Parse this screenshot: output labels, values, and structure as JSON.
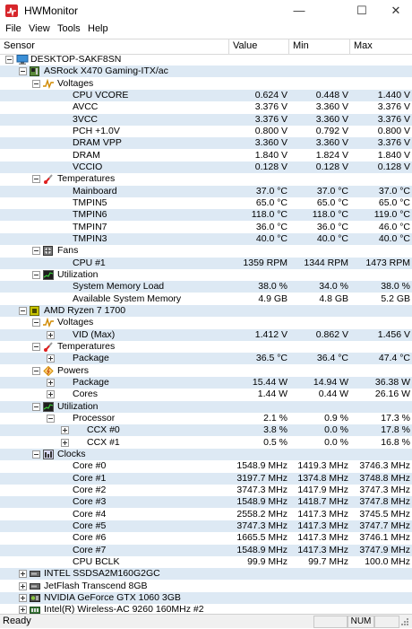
{
  "window": {
    "title": "HWMonitor",
    "minimize": "—",
    "maximize": "☐",
    "close": "✕"
  },
  "menu": [
    "File",
    "View",
    "Tools",
    "Help"
  ],
  "columns": {
    "sensor": "Sensor",
    "value": "Value",
    "min": "Min",
    "max": "Max"
  },
  "tree": [
    {
      "level": 0,
      "type": "root",
      "label": "DESKTOP-SAKF8SN",
      "expander": "minus",
      "icon": "computer-icon"
    },
    {
      "level": 1,
      "type": "device",
      "label": "ASRock X470 Gaming-ITX/ac",
      "expander": "minus",
      "icon": "motherboard-icon"
    },
    {
      "level": 2,
      "type": "group",
      "label": "Voltages",
      "expander": "minus",
      "icon": "voltage-icon"
    },
    {
      "level": 3,
      "type": "sensor",
      "label": "CPU VCORE",
      "value": "0.624 V",
      "min": "0.448 V",
      "max": "1.440 V"
    },
    {
      "level": 3,
      "type": "sensor",
      "label": "AVCC",
      "value": "3.376 V",
      "min": "3.360 V",
      "max": "3.376 V"
    },
    {
      "level": 3,
      "type": "sensor",
      "label": "3VCC",
      "value": "3.376 V",
      "min": "3.360 V",
      "max": "3.376 V"
    },
    {
      "level": 3,
      "type": "sensor",
      "label": "PCH +1.0V",
      "value": "0.800 V",
      "min": "0.792 V",
      "max": "0.800 V"
    },
    {
      "level": 3,
      "type": "sensor",
      "label": "DRAM VPP",
      "value": "3.360 V",
      "min": "3.360 V",
      "max": "3.376 V"
    },
    {
      "level": 3,
      "type": "sensor",
      "label": "DRAM",
      "value": "1.840 V",
      "min": "1.824 V",
      "max": "1.840 V"
    },
    {
      "level": 3,
      "type": "sensor",
      "label": "VCCIO",
      "value": "0.128 V",
      "min": "0.128 V",
      "max": "0.128 V"
    },
    {
      "level": 2,
      "type": "group",
      "label": "Temperatures",
      "expander": "minus",
      "icon": "thermometer-icon"
    },
    {
      "level": 3,
      "type": "sensor",
      "label": "Mainboard",
      "value": "37.0 °C",
      "min": "37.0 °C",
      "max": "37.0 °C"
    },
    {
      "level": 3,
      "type": "sensor",
      "label": "TMPIN5",
      "value": "65.0 °C",
      "min": "65.0 °C",
      "max": "65.0 °C"
    },
    {
      "level": 3,
      "type": "sensor",
      "label": "TMPIN6",
      "value": "118.0 °C",
      "min": "118.0 °C",
      "max": "119.0 °C"
    },
    {
      "level": 3,
      "type": "sensor",
      "label": "TMPIN7",
      "value": "36.0 °C",
      "min": "36.0 °C",
      "max": "46.0 °C"
    },
    {
      "level": 3,
      "type": "sensor",
      "label": "TMPIN3",
      "value": "40.0 °C",
      "min": "40.0 °C",
      "max": "40.0 °C"
    },
    {
      "level": 2,
      "type": "group",
      "label": "Fans",
      "expander": "minus",
      "icon": "fan-icon"
    },
    {
      "level": 3,
      "type": "sensor",
      "label": "CPU #1",
      "value": "1359 RPM",
      "min": "1344 RPM",
      "max": "1473 RPM"
    },
    {
      "level": 2,
      "type": "group",
      "label": "Utilization",
      "expander": "minus",
      "icon": "utilization-icon"
    },
    {
      "level": 3,
      "type": "sensor",
      "label": "System Memory Load",
      "value": "38.0 %",
      "min": "34.0 %",
      "max": "38.0 %"
    },
    {
      "level": 3,
      "type": "sensor",
      "label": "Available System Memory",
      "value": "4.9 GB",
      "min": "4.8 GB",
      "max": "5.2 GB"
    },
    {
      "level": 1,
      "type": "device",
      "label": "AMD Ryzen 7 1700",
      "expander": "minus",
      "icon": "cpu-icon"
    },
    {
      "level": 2,
      "type": "group",
      "label": "Voltages",
      "expander": "minus",
      "icon": "voltage-icon"
    },
    {
      "level": 3,
      "type": "sensor",
      "label": "VID (Max)",
      "value": "1.412 V",
      "min": "0.862 V",
      "max": "1.456 V",
      "expander": "plus"
    },
    {
      "level": 2,
      "type": "group",
      "label": "Temperatures",
      "expander": "minus",
      "icon": "thermometer-icon"
    },
    {
      "level": 3,
      "type": "sensor",
      "label": "Package",
      "value": "36.5 °C",
      "min": "36.4 °C",
      "max": "47.4 °C",
      "expander": "plus"
    },
    {
      "level": 2,
      "type": "group",
      "label": "Powers",
      "expander": "minus",
      "icon": "power-icon"
    },
    {
      "level": 3,
      "type": "sensor",
      "label": "Package",
      "value": "15.44 W",
      "min": "14.94 W",
      "max": "36.38 W",
      "expander": "plus"
    },
    {
      "level": 3,
      "type": "sensor",
      "label": "Cores",
      "value": "1.44 W",
      "min": "0.44 W",
      "max": "26.16 W",
      "expander": "plus"
    },
    {
      "level": 2,
      "type": "group",
      "label": "Utilization",
      "expander": "minus",
      "icon": "utilization-icon"
    },
    {
      "level": 3,
      "type": "sensor",
      "label": "Processor",
      "value": "2.1 %",
      "min": "0.9 %",
      "max": "17.3 %",
      "expander": "minus"
    },
    {
      "level": 4,
      "type": "sensor",
      "label": "CCX #0",
      "value": "3.8 %",
      "min": "0.0 %",
      "max": "17.8 %",
      "expander": "plus"
    },
    {
      "level": 4,
      "type": "sensor",
      "label": "CCX #1",
      "value": "0.5 %",
      "min": "0.0 %",
      "max": "16.8 %",
      "expander": "plus"
    },
    {
      "level": 2,
      "type": "group",
      "label": "Clocks",
      "expander": "minus",
      "icon": "clock-icon"
    },
    {
      "level": 3,
      "type": "sensor",
      "label": "Core #0",
      "value": "1548.9 MHz",
      "min": "1419.3 MHz",
      "max": "3746.3 MHz"
    },
    {
      "level": 3,
      "type": "sensor",
      "label": "Core #1",
      "value": "3197.7 MHz",
      "min": "1374.8 MHz",
      "max": "3748.8 MHz"
    },
    {
      "level": 3,
      "type": "sensor",
      "label": "Core #2",
      "value": "3747.3 MHz",
      "min": "1417.9 MHz",
      "max": "3747.3 MHz"
    },
    {
      "level": 3,
      "type": "sensor",
      "label": "Core #3",
      "value": "1548.9 MHz",
      "min": "1418.7 MHz",
      "max": "3747.8 MHz"
    },
    {
      "level": 3,
      "type": "sensor",
      "label": "Core #4",
      "value": "2558.2 MHz",
      "min": "1417.3 MHz",
      "max": "3745.5 MHz"
    },
    {
      "level": 3,
      "type": "sensor",
      "label": "Core #5",
      "value": "3747.3 MHz",
      "min": "1417.3 MHz",
      "max": "3747.7 MHz"
    },
    {
      "level": 3,
      "type": "sensor",
      "label": "Core #6",
      "value": "1665.5 MHz",
      "min": "1417.3 MHz",
      "max": "3746.1 MHz"
    },
    {
      "level": 3,
      "type": "sensor",
      "label": "Core #7",
      "value": "1548.9 MHz",
      "min": "1417.3 MHz",
      "max": "3747.9 MHz"
    },
    {
      "level": 3,
      "type": "sensor",
      "label": "CPU BCLK",
      "value": "99.9 MHz",
      "min": "99.7 MHz",
      "max": "100.0 MHz"
    },
    {
      "level": 1,
      "type": "device",
      "label": "INTEL SSDSA2M160G2GC",
      "expander": "plus",
      "icon": "drive-icon"
    },
    {
      "level": 1,
      "type": "device",
      "label": "JetFlash Transcend 8GB",
      "expander": "plus",
      "icon": "drive-icon"
    },
    {
      "level": 1,
      "type": "device",
      "label": "NVIDIA GeForce GTX 1060 3GB",
      "expander": "plus",
      "icon": "gpu-icon"
    },
    {
      "level": 1,
      "type": "device",
      "label": "Intel(R) Wireless-AC 9260 160MHz #2",
      "expander": "plus",
      "icon": "network-icon"
    }
  ],
  "status": {
    "text": "Ready",
    "num": "NUM"
  },
  "colors": {
    "alt_row": "#dde9f4",
    "app_red": "#d7262b"
  }
}
